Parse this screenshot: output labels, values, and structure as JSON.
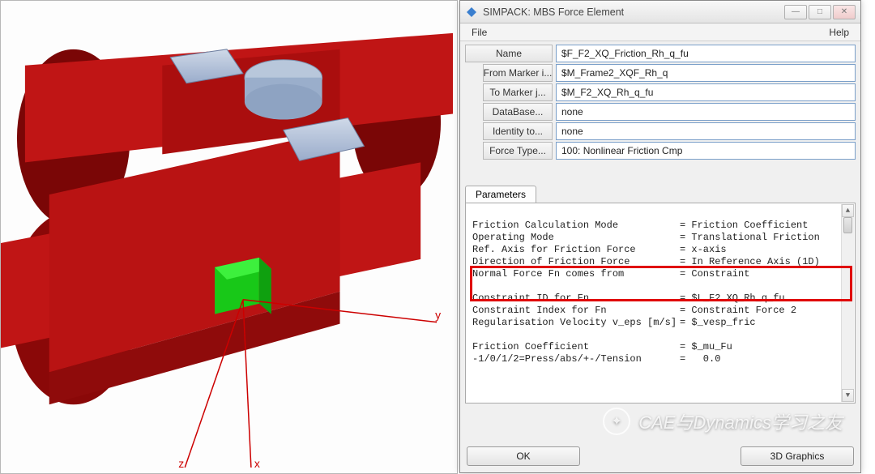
{
  "window": {
    "title": "SIMPACK: MBS Force Element",
    "menu_file": "File",
    "menu_help": "Help"
  },
  "properties": {
    "name_label": "Name",
    "name_value": "$F_F2_XQ_Friction_Rh_q_fu",
    "from_marker_label": "From Marker i...",
    "from_marker_value": "$M_Frame2_XQF_Rh_q",
    "to_marker_label": "To Marker j...",
    "to_marker_value": "$M_F2_XQ_Rh_q_fu",
    "database_label": "DataBase...",
    "database_value": "none",
    "identity_label": "Identity to...",
    "identity_value": "none",
    "forcetype_label": "Force Type...",
    "forcetype_value": "100: Nonlinear Friction   Cmp"
  },
  "tabs": {
    "parameters": "Parameters"
  },
  "parameters": {
    "l1a": "Friction Calculation Mode",
    "l1b": "= Friction Coefficient",
    "l2a": "Operating Mode",
    "l2b": "= Translational Friction",
    "l3a": "Ref. Axis for Friction Force",
    "l3b": "= x-axis",
    "l4a": "Direction of Friction Force",
    "l4b": "= In Reference Axis (1D)",
    "l5a": "Normal Force Fn comes from",
    "l5b": "= Constraint",
    "l6a": "Constraint ID for Fn",
    "l6b": "= $L_F2_XQ_Rh_q_fu",
    "l7a": "Constraint Index for Fn",
    "l7b": "= Constraint Force 2",
    "l8a": "Regularisation Velocity v_eps [m/s]",
    "l8b": "= $_vesp_fric",
    "l9a": "Friction Coefficient",
    "l9b": "= $_mu_Fu",
    "l10a": "-1/0/1/2=Press/abs/+-/Tension",
    "l10b": "=   0.0"
  },
  "buttons": {
    "ok": "OK",
    "threeD": "3D Graphics"
  },
  "axis": {
    "x": "x",
    "y": "y",
    "z": "z"
  },
  "watermark": {
    "text": "CAE与Dynamics学习之友"
  }
}
